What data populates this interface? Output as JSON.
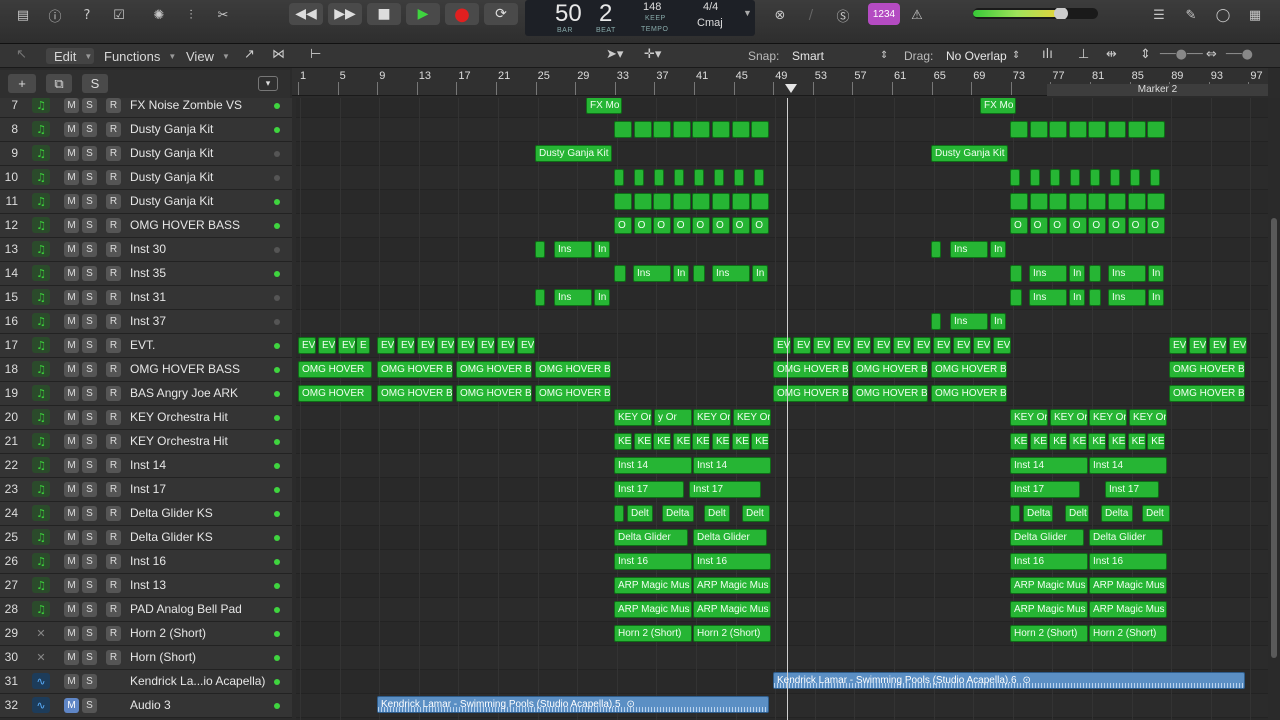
{
  "transport": {
    "bar": "50",
    "beat": "2",
    "bar_label": "BAR",
    "beat_label": "BEAT",
    "tempo": "148",
    "tempo_mode": "KEEP",
    "tempo_label": "TEMPO",
    "time_signature": "4/4",
    "key": "Cmaj",
    "cpu_label": "1234",
    "master_volume_level": 0.7
  },
  "toolbar": {
    "edit_menu": "Edit",
    "functions_menu": "Functions",
    "view_menu": "View",
    "snap_label": "Snap:",
    "snap_value": "Smart",
    "drag_label": "Drag:",
    "drag_value": "No Overlap"
  },
  "tracklist_header": {
    "add_button": "+",
    "solo_button": "S"
  },
  "ruler": {
    "bars": [
      "1",
      "5",
      "9",
      "13",
      "17",
      "21",
      "25",
      "29",
      "33",
      "37",
      "41",
      "45",
      "49",
      "53",
      "57",
      "61",
      "65",
      "69",
      "73",
      "77",
      "81",
      "85",
      "89",
      "93",
      "97"
    ],
    "marker_label": "Marker 2"
  },
  "tracks": [
    {
      "num": "7",
      "name": "FX Noise Zombie VS",
      "type": "inst",
      "led": true,
      "mute": false
    },
    {
      "num": "8",
      "name": "Dusty Ganja Kit",
      "type": "inst",
      "led": true,
      "mute": false
    },
    {
      "num": "9",
      "name": "Dusty Ganja Kit",
      "type": "inst",
      "led": false,
      "mute": false
    },
    {
      "num": "10",
      "name": "Dusty Ganja Kit",
      "type": "inst",
      "led": false,
      "mute": false
    },
    {
      "num": "11",
      "name": "Dusty Ganja Kit",
      "type": "inst",
      "led": true,
      "mute": false
    },
    {
      "num": "12",
      "name": "OMG HOVER BASS",
      "type": "inst",
      "led": true,
      "mute": false
    },
    {
      "num": "13",
      "name": "Inst 30",
      "type": "inst",
      "led": false,
      "mute": false
    },
    {
      "num": "14",
      "name": "Inst 35",
      "type": "inst",
      "led": true,
      "mute": false
    },
    {
      "num": "15",
      "name": "Inst 31",
      "type": "inst",
      "led": false,
      "mute": false
    },
    {
      "num": "16",
      "name": "Inst 37",
      "type": "inst",
      "led": false,
      "mute": false
    },
    {
      "num": "17",
      "name": "EVT.",
      "type": "inst",
      "led": true,
      "mute": false
    },
    {
      "num": "18",
      "name": "OMG HOVER BASS",
      "type": "inst",
      "led": true,
      "mute": false
    },
    {
      "num": "19",
      "name": "BAS Angry Joe ARK",
      "type": "inst",
      "led": true,
      "mute": false
    },
    {
      "num": "20",
      "name": "KEY Orchestra Hit",
      "type": "inst",
      "led": true,
      "mute": false
    },
    {
      "num": "21",
      "name": "KEY Orchestra Hit",
      "type": "inst",
      "led": true,
      "mute": false
    },
    {
      "num": "22",
      "name": "Inst 14",
      "type": "inst",
      "led": true,
      "mute": false
    },
    {
      "num": "23",
      "name": "Inst 17",
      "type": "inst",
      "led": true,
      "mute": false
    },
    {
      "num": "24",
      "name": "Delta Glider KS",
      "type": "inst",
      "led": true,
      "mute": false
    },
    {
      "num": "25",
      "name": "Delta Glider KS",
      "type": "inst",
      "led": true,
      "mute": false
    },
    {
      "num": "26",
      "name": "Inst 16",
      "type": "inst",
      "led": true,
      "mute": false
    },
    {
      "num": "27",
      "name": "Inst 13",
      "type": "inst",
      "led": true,
      "mute": false
    },
    {
      "num": "28",
      "name": "PAD Analog Bell Pad",
      "type": "inst",
      "led": true,
      "mute": false
    },
    {
      "num": "29",
      "name": "Horn 2 (Short)",
      "type": "none",
      "led": true,
      "mute": false
    },
    {
      "num": "30",
      "name": "Horn (Short)",
      "type": "none",
      "led": true,
      "mute": false
    },
    {
      "num": "31",
      "name": "Kendrick La...io Acapella)",
      "type": "audio",
      "led": true,
      "mute": false
    },
    {
      "num": "32",
      "name": "Audio 3",
      "type": "audio",
      "led": true,
      "mute": true
    }
  ],
  "regions": {
    "fx_mo": "FX Mo",
    "dusty": "Dusty Ganja Kit",
    "o": "O",
    "ins": "Ins",
    "in": "In",
    "ev": "EV",
    "e": "E",
    "omg_full": "OMG HOVER",
    "omg_b": "OMG HOVER B",
    "key_or": "KEY Or",
    "key_or_short": "y Or",
    "ke": "KE",
    "inst14": "Inst 14",
    "inst17": "Inst 17",
    "delt": "Delt",
    "delta": "Delta",
    "delta_glider": "Delta Glider",
    "inst16": "Inst 16",
    "arp": "ARP Magic Mus",
    "horn": "Horn 2 (Short)",
    "kendrick_6": "Kendrick Lamar - Swimming Pools (Studio Acapella).6",
    "kendrick_5": "Kendrick Lamar - Swimming Pools (Studio Acapella).5",
    "loop_icon": "⊙"
  }
}
